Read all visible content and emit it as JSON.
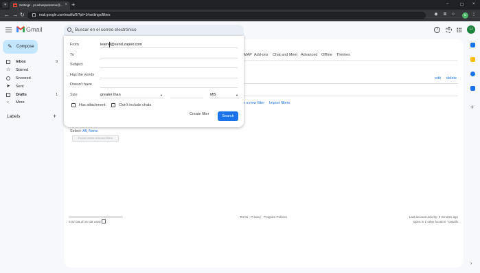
{
  "browser": {
    "tab_title": "Settings - pruebasparatutos@...",
    "url": "mail.google.com/mail/u/0/?pli=1#settings/filters",
    "new_tab": "+",
    "window_controls": [
      "–",
      "▢",
      "×"
    ],
    "profile_initial": "u"
  },
  "header": {
    "logo_text": "Gmail",
    "search_placeholder": "Buscar en el correo electrónico",
    "avatar_initial": "U"
  },
  "sidebar": {
    "compose_label": "Compose",
    "items": [
      {
        "label": "Inbox",
        "count": "9",
        "bold": true
      },
      {
        "label": "Starred",
        "count": ""
      },
      {
        "label": "Snoozed",
        "count": ""
      },
      {
        "label": "Sent",
        "count": ""
      },
      {
        "label": "Drafts",
        "count": "1",
        "bold": true
      },
      {
        "label": "More",
        "count": ""
      }
    ],
    "labels_title": "Labels"
  },
  "settings_tabs": [
    "MAP",
    "Add-ons",
    "Chat and Meet",
    "Advanced",
    "Offline",
    "Themes"
  ],
  "filters": {
    "edit": "edit",
    "delete": "delete",
    "create_filter_link": "e a new filter",
    "import_filters": "Import filters",
    "select_prefix": "Select:",
    "select_all": "All",
    "select_none": "None",
    "export_button": "Export delete selected filters"
  },
  "footer": {
    "storage": "0.02 GB of 15 GB used",
    "terms": "Terms · Privacy · Program Policies",
    "last_activity": "Last account activity: 0 minutes ago",
    "open_location": "Open in 1 other location · Details"
  },
  "search_options": {
    "from_label": "From",
    "from_value": "learnd@send.zapier.com",
    "to_label": "To",
    "subject_label": "Subject",
    "has_words_label": "Has the words",
    "doesnt_have_label": "Doesn't have",
    "size_label": "Size",
    "size_operator": "greater than",
    "size_unit": "MB",
    "has_attachment_label": "Has attachment",
    "dont_include_chats_label": "Don't include chats",
    "create_filter_label": "Create filter",
    "search_button_label": "Search"
  },
  "colors": {
    "primary": "#1a73e8",
    "compose_bg": "#c2e7ff",
    "page_bg": "#f6f8fc"
  }
}
